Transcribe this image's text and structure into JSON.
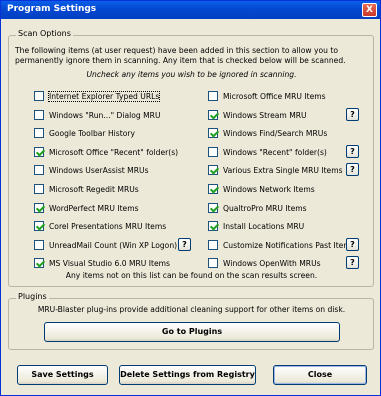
{
  "window": {
    "title": "Program Settings",
    "close_glyph": "X"
  },
  "scan_options": {
    "legend": "Scan Options",
    "intro": "The following items (at user request) have been added in this section to allow you to permanently ignore them in scanning. Any item that is checked below will be scanned.",
    "uncheck_hint": "Uncheck any items you wish to be ignored in scanning.",
    "left_items": [
      {
        "label": "Internet Explorer Typed URLs",
        "checked": false,
        "help": false
      },
      {
        "label": "Windows \"Run...\" Dialog MRU",
        "checked": false,
        "help": false
      },
      {
        "label": "Google Toolbar History",
        "checked": false,
        "help": false
      },
      {
        "label": "Microsoft Office \"Recent\" folder(s)",
        "checked": true,
        "help": false
      },
      {
        "label": "Windows UserAssist MRUs",
        "checked": false,
        "help": false
      },
      {
        "label": "Microsoft Regedit MRUs",
        "checked": false,
        "help": false
      },
      {
        "label": "WordPerfect MRU Items",
        "checked": true,
        "help": false
      },
      {
        "label": "Corel Presentations MRU Items",
        "checked": true,
        "help": false
      },
      {
        "label": "UnreadMail Count (Win XP Logon)",
        "checked": false,
        "help": true
      },
      {
        "label": "MS Visual Studio 6.0 MRU Items",
        "checked": true,
        "help": false
      }
    ],
    "right_items": [
      {
        "label": "Microsoft Office MRU Items",
        "checked": false,
        "help": false
      },
      {
        "label": "Windows Stream MRU",
        "checked": true,
        "help": true
      },
      {
        "label": "Windows Find/Search MRUs",
        "checked": true,
        "help": false
      },
      {
        "label": "Windows \"Recent\" folder(s)",
        "checked": false,
        "help": true
      },
      {
        "label": "Various Extra Single MRU Items",
        "checked": true,
        "help": true
      },
      {
        "label": "Windows Network Items",
        "checked": true,
        "help": false
      },
      {
        "label": "QualtroPro MRU Items",
        "checked": true,
        "help": false
      },
      {
        "label": "Install Locations MRU",
        "checked": true,
        "help": false
      },
      {
        "label": "Customize Notifications Past Items",
        "checked": false,
        "help": true
      },
      {
        "label": "Windows OpenWith MRUs",
        "checked": false,
        "help": true
      }
    ],
    "help_glyph": "?",
    "note": "Any items not on this list can be found on the scan results screen."
  },
  "plugins": {
    "legend": "Plugins",
    "text": "MRU-Blaster plug-ins provide additional cleaning support for other items on disk.",
    "go_button": "Go to Plugins"
  },
  "buttons": {
    "save": "Save Settings",
    "delete": "Delete Settings from Registry",
    "close": "Close"
  },
  "colors": {
    "title_bar": "#0548d0",
    "dialog_bg": "#ece9d8",
    "check_mark": "#21a121"
  }
}
